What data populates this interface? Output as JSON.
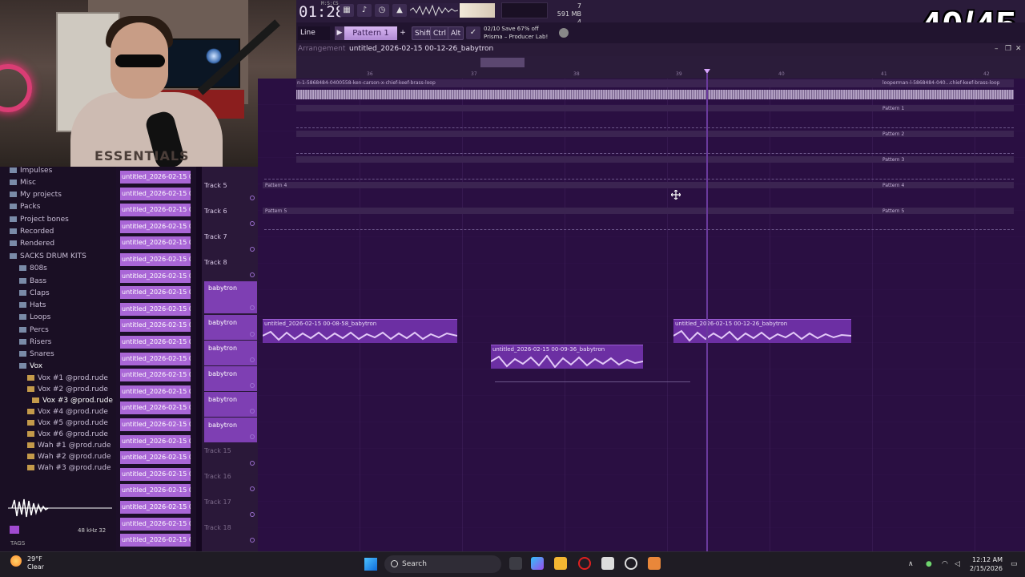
{
  "overlay": {
    "counter": "40/45"
  },
  "transport": {
    "time_main": "01:28",
    "time_label": "M:S:CS",
    "mem_top": "7",
    "mem_value": "591 MB",
    "mem_bottom": "4"
  },
  "toolbar2": {
    "mode": "Line",
    "pattern": "Pattern 1",
    "key_shift": "Shift",
    "key_ctrl": "Ctrl",
    "key_alt": "Alt",
    "promo_line1": "02/10  Save 67% off",
    "promo_line2": "Prisma – Producer Lab!"
  },
  "playlist": {
    "title_a": "Arrangement",
    "title_b": "untitled_2026-02-15 00-12-26_babytron",
    "ruler": [
      "36",
      "37",
      "38",
      "39",
      "40",
      "41",
      "42"
    ]
  },
  "lanes": {
    "loop_left": "n-1-5868484-0400558-ken-carson-x-chief-keef-brass-loop",
    "loop_right": "looperman-l-5868484-040...chief-keef-brass-loop",
    "patterns": [
      "Pattern 1",
      "Pattern 2",
      "Pattern 3",
      "Pattern 4",
      "Pattern 5"
    ]
  },
  "browser": {
    "items": [
      "Impulses",
      "Misc",
      "My projects",
      "Packs",
      "Project bones",
      "Recorded",
      "Rendered",
      "SACKS DRUM KITS"
    ],
    "sacks": [
      "808s",
      "Bass",
      "Claps",
      "Hats",
      "Loops",
      "Percs",
      "Risers",
      "Snares",
      "Vox"
    ],
    "vox": [
      "Vox #1 @prod.rude",
      "Vox #2 @prod.rude",
      "Vox #3 @prod.rude",
      "Vox #4 @prod.rude",
      "Vox #5 @prod.rude",
      "Vox #6 @prod.rude",
      "Wah #1 @prod.rude",
      "Wah #2 @prod.rude",
      "Wah #3 @prod.rude"
    ],
    "sample_rate": "48 kHz 32",
    "tags": "TAGS"
  },
  "pattern_list_label": "untitled_2026-02-15 00-...",
  "tracks": {
    "t5": "Track 5",
    "t6": "Track 6",
    "t7": "Track 7",
    "t8": "Track 8",
    "babytron": "babytron",
    "t15": "Track 15",
    "t16": "Track 16",
    "t17": "Track 17",
    "t18": "Track 18"
  },
  "clips": {
    "c1": "untitled_2026-02-15 00-08-58_babytron",
    "c2": "untitled_2026-02-15 00-09-36_babytron",
    "c3": "untitled_2026-02-15 00-12-26_babytron"
  },
  "taskbar": {
    "temp": "29°F",
    "cond": "Clear",
    "search": "Search",
    "time": "12:12 AM",
    "date": "2/15/2026"
  },
  "webcam": {
    "shirt": "ESSENTIALS"
  }
}
